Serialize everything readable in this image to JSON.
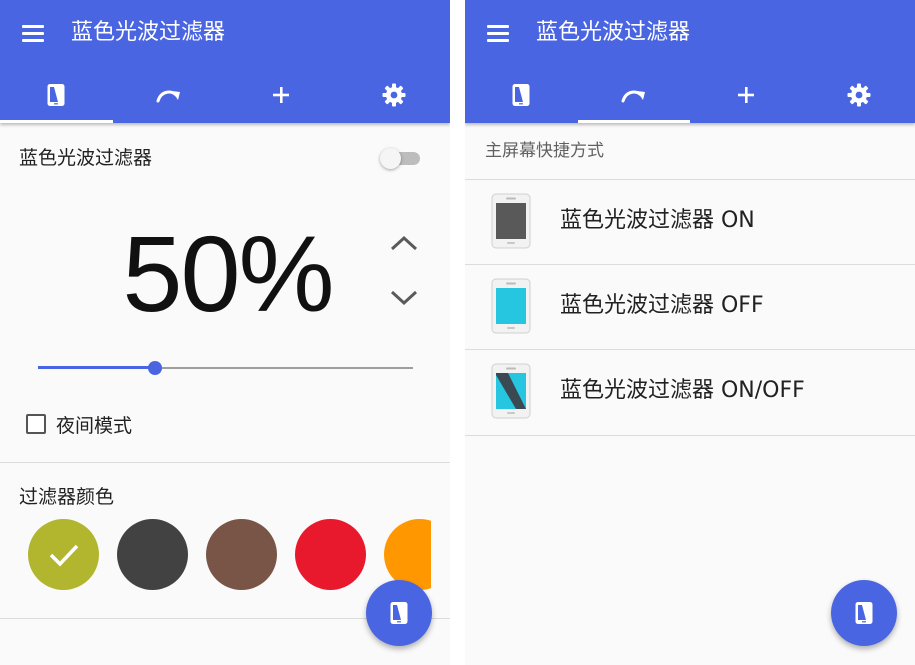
{
  "left": {
    "app_title": "蓝色光波过滤器",
    "tabs": [
      {
        "icon": "phone-filter-icon",
        "active": true
      },
      {
        "icon": "shortcut-arrow-icon",
        "active": false
      },
      {
        "icon": "plus-icon",
        "active": false
      },
      {
        "icon": "gear-icon",
        "active": false
      }
    ],
    "filter_label": "蓝色光波过滤器",
    "filter_enabled": false,
    "opacity_text": "50%",
    "opacity_value": 50,
    "night_mode_label": "夜间模式",
    "night_mode_checked": false,
    "color_section_label": "过滤器颜色",
    "colors": [
      {
        "hex": "#b1b62e",
        "selected": true
      },
      {
        "hex": "#424242",
        "selected": false
      },
      {
        "hex": "#795548",
        "selected": false
      },
      {
        "hex": "#e8192c",
        "selected": false
      },
      {
        "hex": "#ff9800",
        "selected": false
      }
    ]
  },
  "right": {
    "app_title": "蓝色光波过滤器",
    "tabs": [
      {
        "icon": "phone-filter-icon",
        "active": false
      },
      {
        "icon": "shortcut-arrow-icon",
        "active": true
      },
      {
        "icon": "plus-icon",
        "active": false
      },
      {
        "icon": "gear-icon",
        "active": false
      }
    ],
    "section_header": "主屏幕快捷方式",
    "shortcuts": [
      {
        "label": "蓝色光波过滤器 ON",
        "icon": "phone-dark-icon"
      },
      {
        "label": "蓝色光波过滤器 OFF",
        "icon": "phone-cyan-icon"
      },
      {
        "label": "蓝色光波过滤器 ON/OFF",
        "icon": "phone-split-icon"
      }
    ]
  },
  "theme": {
    "primary": "#4a65e2",
    "background": "#fafafa"
  }
}
